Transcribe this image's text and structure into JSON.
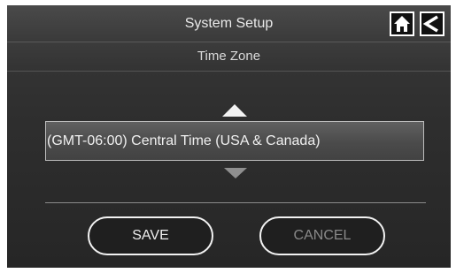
{
  "header": {
    "title": "System Setup",
    "subtitle": "Time Zone"
  },
  "icons": {
    "home": "home-icon",
    "back": "back-arrow-icon",
    "scroll_up": "triangle-up-icon",
    "scroll_down": "triangle-down-icon"
  },
  "timezone": {
    "selected": "(GMT-06:00) Central Time (USA & Canada)"
  },
  "buttons": {
    "save_label": "SAVE",
    "cancel_label": "CANCEL"
  },
  "colors": {
    "background": "#2f2f2f",
    "text": "#e6e6e6",
    "disabled_text": "#8a8a8a",
    "border": "#f2f2f2"
  }
}
